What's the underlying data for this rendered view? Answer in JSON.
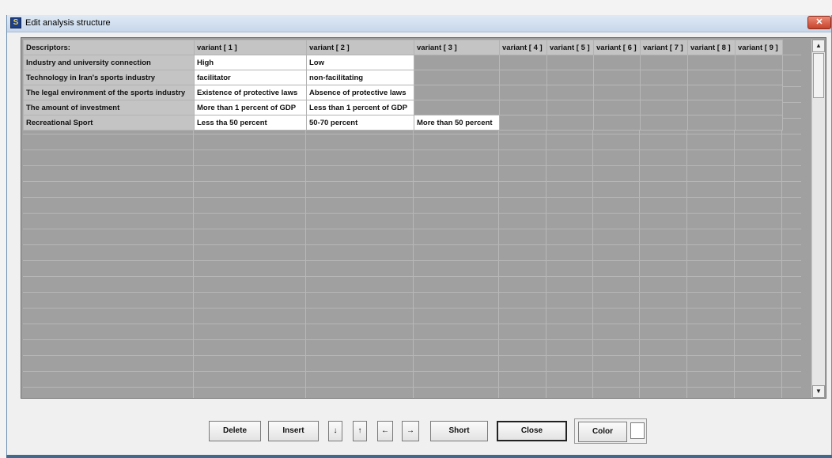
{
  "window": {
    "title": "Edit analysis structure",
    "close_glyph": "✕"
  },
  "grid": {
    "headers": [
      "Descriptors:",
      "variant [ 1 ]",
      "variant [ 2 ]",
      "variant [ 3 ]",
      "variant [ 4 ]",
      "variant [ 5 ]",
      "variant [ 6 ]",
      "variant [ 7 ]",
      "variant [ 8 ]",
      "variant [ 9 ]"
    ],
    "rows": [
      {
        "descriptor": "Industry and university connection",
        "variants": [
          "High",
          "Low"
        ]
      },
      {
        "descriptor": "Technology in Iran's sports industry",
        "variants": [
          "facilitator",
          "non-facilitating"
        ]
      },
      {
        "descriptor": "The legal environment of the sports industry",
        "variants": [
          "Existence of protective laws",
          "Absence of protective laws"
        ]
      },
      {
        "descriptor": "The amount of investment",
        "variants": [
          "More than 1 percent of GDP",
          "Less than 1 percent of GDP"
        ]
      },
      {
        "descriptor": "Recreational Sport",
        "variants": [
          "Less tha 50 percent",
          "50-70 percent",
          "More than 50 percent"
        ]
      }
    ]
  },
  "scrollbar": {
    "up_glyph": "▲",
    "down_glyph": "▼"
  },
  "buttons": {
    "delete": "Delete",
    "insert": "Insert",
    "down": "↓",
    "up": "↑",
    "left": "←",
    "right": "→",
    "short": "Short",
    "close": "Close",
    "color": "Color"
  },
  "colors": {
    "grid_background": "#a0a0a0",
    "header_background": "#c4c4c4",
    "value_background": "#ffffff",
    "color_swatch": "#ffffff"
  }
}
